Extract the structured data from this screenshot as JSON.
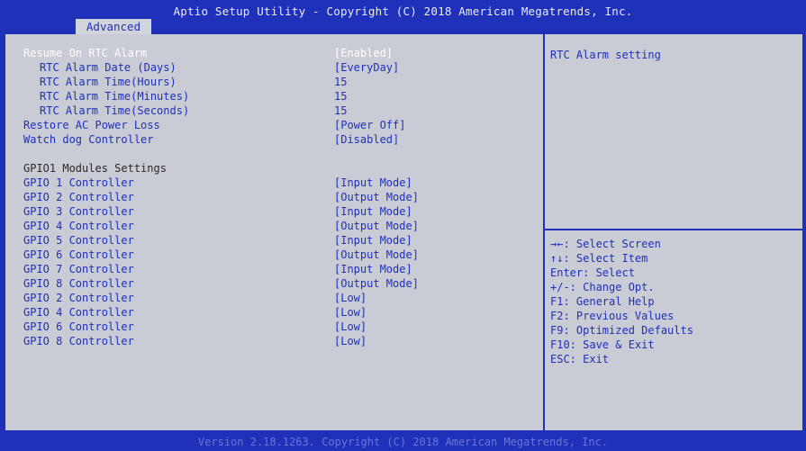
{
  "title": "Aptio Setup Utility - Copyright (C) 2018 American Megatrends, Inc.",
  "tab": "Advanced",
  "settings": [
    {
      "label": "Resume On RTC Alarm",
      "value": "[Enabled]"
    },
    {
      "label": "RTC Alarm Date (Days)",
      "value": "[EveryDay]"
    },
    {
      "label": "RTC Alarm Time(Hours)",
      "value": "15"
    },
    {
      "label": "RTC Alarm Time(Minutes)",
      "value": "15"
    },
    {
      "label": "RTC Alarm Time(Seconds)",
      "value": "15"
    },
    {
      "label": "Restore AC Power Loss",
      "value": "[Power Off]"
    },
    {
      "label": "Watch dog Controller",
      "value": "[Disabled]"
    }
  ],
  "gpio_header": "GPIO1 Modules Settings",
  "gpio": [
    {
      "label": "GPIO 1 Controller",
      "value": "[Input Mode]"
    },
    {
      "label": "GPIO 2 Controller",
      "value": "[Output Mode]"
    },
    {
      "label": "GPIO 3 Controller",
      "value": "[Input Mode]"
    },
    {
      "label": "GPIO 4 Controller",
      "value": "[Output Mode]"
    },
    {
      "label": "GPIO 5 Controller",
      "value": "[Input Mode]"
    },
    {
      "label": "GPIO 6 Controller",
      "value": "[Output Mode]"
    },
    {
      "label": "GPIO 7 Controller",
      "value": "[Input Mode]"
    },
    {
      "label": "GPIO 8 Controller",
      "value": "[Output Mode]"
    },
    {
      "label": "GPIO 2 Controller",
      "value": "[Low]"
    },
    {
      "label": "GPIO 4 Controller",
      "value": "[Low]"
    },
    {
      "label": "GPIO 6 Controller",
      "value": "[Low]"
    },
    {
      "label": "GPIO 8 Controller",
      "value": "[Low]"
    }
  ],
  "help_text": "RTC Alarm setting",
  "keys": [
    "→←: Select Screen",
    "↑↓: Select Item",
    "Enter: Select",
    "+/-: Change Opt.",
    "F1: General Help",
    "F2: Previous Values",
    "F9: Optimized Defaults",
    "F10: Save & Exit",
    "ESC: Exit"
  ],
  "footer": "Version 2.18.1263. Copyright (C) 2018 American Megatrends, Inc.",
  "colors": {
    "background": "#1f31b8",
    "panel": "#c9cbd5",
    "text": "#1f31b8",
    "highlight": "#ffffff"
  }
}
